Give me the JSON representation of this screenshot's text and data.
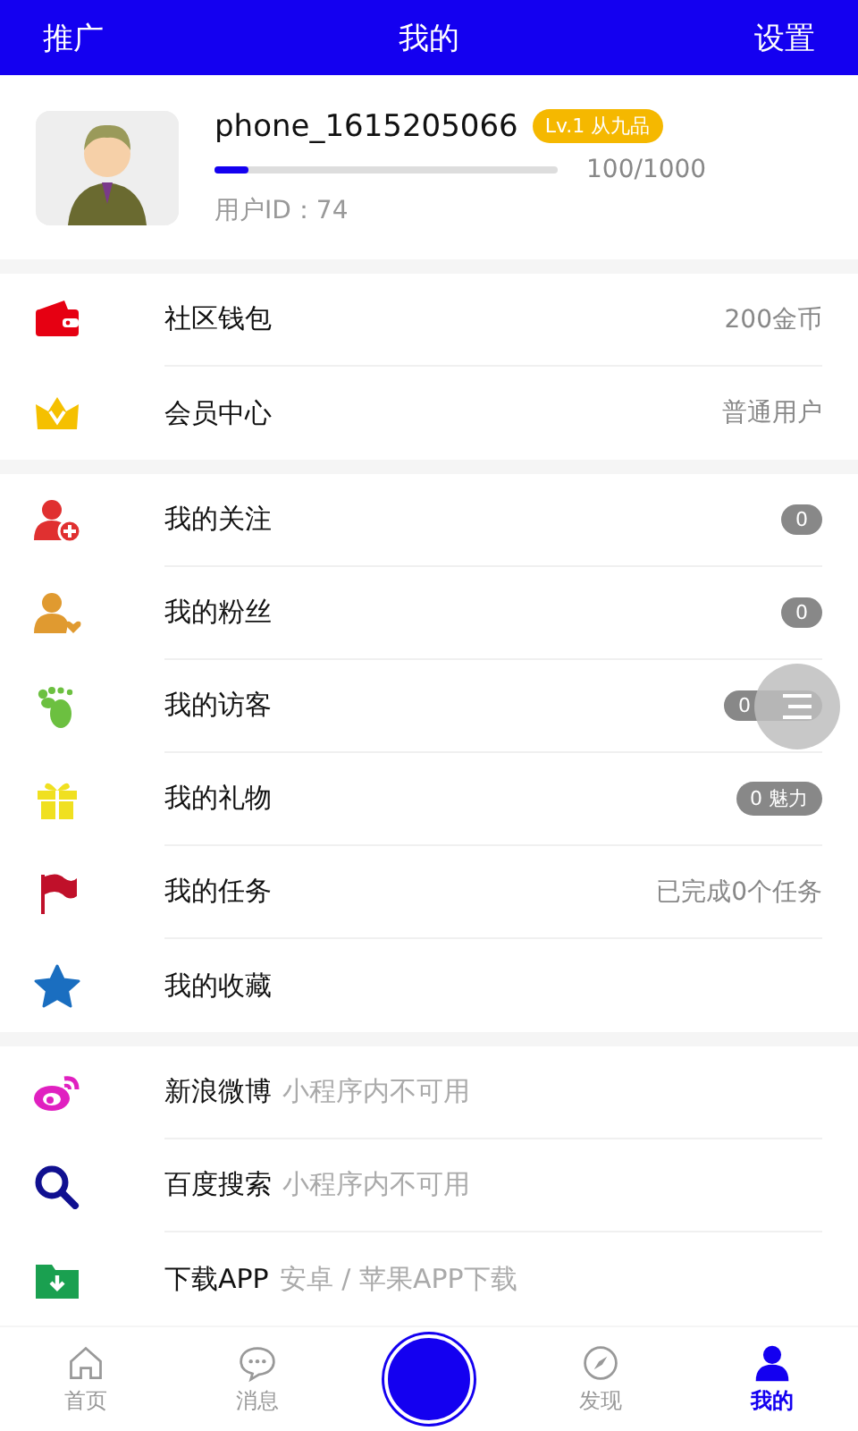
{
  "header": {
    "left": "推广",
    "title": "我的",
    "right": "设置"
  },
  "profile": {
    "username": "phone_1615205066",
    "level_badge": "Lv.1 从九品",
    "progress": {
      "level": 0.1,
      "reading": "100/1000"
    },
    "user_id": "用户ID：74"
  },
  "sections": [
    {
      "items": [
        {
          "label": "社区钱包",
          "kind": "text",
          "value": "200金币"
        },
        {
          "label": "会员中心",
          "kind": "text",
          "value": "普通用户"
        }
      ]
    },
    {
      "items": [
        {
          "label": "我的关注",
          "kind": "badge",
          "value": "0"
        },
        {
          "label": "我的粉丝",
          "kind": "badge",
          "value": "0"
        },
        {
          "label": "我的访客",
          "kind": "badge",
          "value": "0",
          "floating_button": true
        },
        {
          "label": "我的礼物",
          "kind": "badge",
          "value": "0 魅力"
        },
        {
          "label": "我的任务",
          "kind": "text",
          "value": "已完成0个任务"
        },
        {
          "label": "我的收藏",
          "kind": "none"
        }
      ]
    },
    {
      "items": [
        {
          "label": "新浪微博",
          "kind": "hint",
          "value": "小程序内不可用"
        },
        {
          "label": "百度搜索",
          "kind": "hint",
          "value": "小程序内不可用"
        },
        {
          "label": "下载APP",
          "kind": "hint",
          "value": "安卓 / 苹果APP下载"
        }
      ]
    }
  ],
  "tabs": [
    {
      "kind": "tab",
      "label": "首页",
      "selected": false
    },
    {
      "kind": "tab",
      "label": "消息",
      "selected": false
    },
    {
      "kind": "center",
      "selected": false
    },
    {
      "kind": "tab",
      "label": "发现",
      "selected": false
    },
    {
      "kind": "tab",
      "label": "我的",
      "selected": true
    }
  ]
}
